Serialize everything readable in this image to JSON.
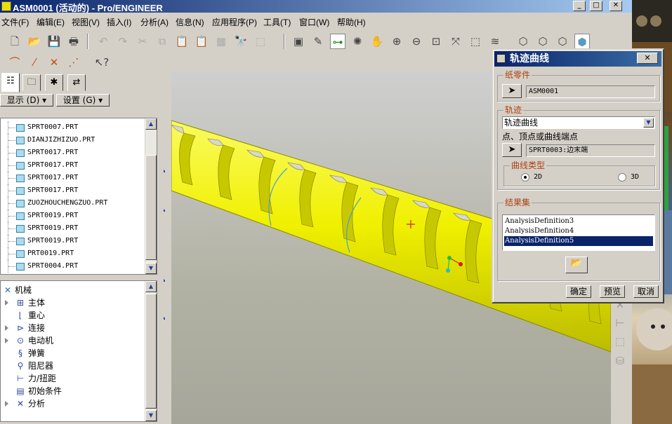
{
  "window": {
    "title": "ASM0001 (活动的) - Pro/ENGINEER"
  },
  "menubar": {
    "items": [
      "文件(F)",
      "编辑(E)",
      "视图(V)",
      "插入(I)",
      "分析(A)",
      "信息(N)",
      "应用程序(P)",
      "工具(T)",
      "窗口(W)",
      "帮助(H)"
    ]
  },
  "left_panel": {
    "show_button": "显示 (D) ▾",
    "settings_button": "设置 (G) ▾",
    "model_tree": [
      "SPRT0007.PRT",
      "DIANJIZHIZUO.PRT",
      "SPRT0017.PRT",
      "SPRT0017.PRT",
      "SPRT0017.PRT",
      "SPRT0017.PRT",
      "ZUOZHOUCHENGZUO.PRT",
      "SPRT0019.PRT",
      "SPRT0019.PRT",
      "SPRT0019.PRT",
      "PRT0019.PRT",
      "SPRT0004.PRT"
    ],
    "mechanism_tree": {
      "root": "机械",
      "items": [
        "主体",
        "重心",
        "连接",
        "电动机",
        "弹簧",
        "阻尼器",
        "力/扭距",
        "初始条件",
        "分析"
      ]
    }
  },
  "dialog": {
    "title": "轨迹曲线",
    "paper_part_label": "纸零件",
    "paper_part_value": "ASM0001",
    "trajectory_label": "轨迹",
    "trajectory_type": "轨迹曲线",
    "point_hint": "点、顶点或曲线端点",
    "point_value": "SPRT0003:边末端",
    "curve_type_label": "曲线类型",
    "option_2d": "2D",
    "option_3d": "3D",
    "curve_type_selected": "2D",
    "results_label": "结果集",
    "results": [
      "AnalysisDefinition3",
      "AnalysisDefinition4",
      "AnalysisDefinition5"
    ],
    "results_selected": "AnalysisDefinition5",
    "ok_button": "确定",
    "preview_button": "预览",
    "cancel_button": "取消"
  },
  "colors": {
    "model": "#f0f000",
    "titlebar": "#0a246a",
    "selection": "#0a246a",
    "group_label": "#b04010"
  }
}
